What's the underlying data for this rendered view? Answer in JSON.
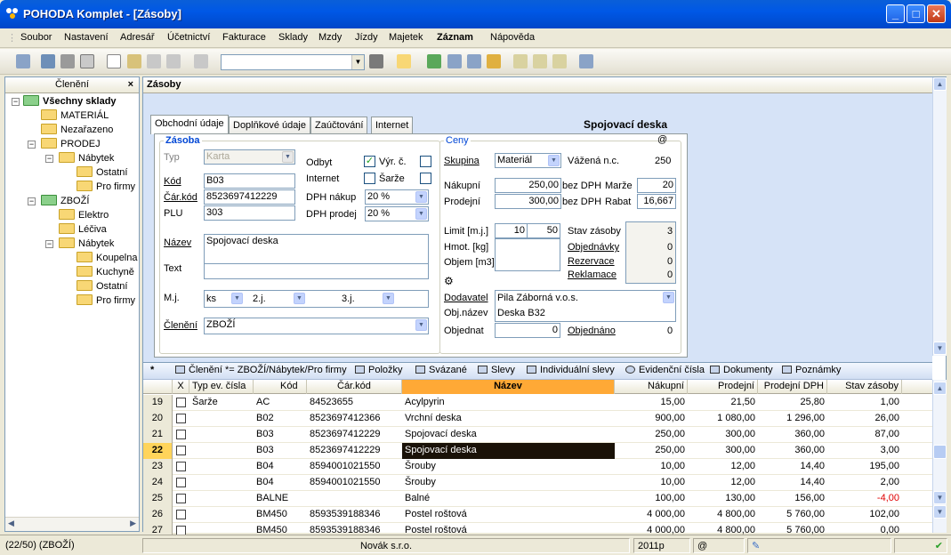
{
  "window": {
    "title": "POHODA Komplet - [Zásoby]"
  },
  "menu": [
    "Soubor",
    "Nastavení",
    "Adresář",
    "Účetnictví",
    "Fakturace",
    "Sklady",
    "Mzdy",
    "Jízdy",
    "Majetek",
    "Záznam",
    "Nápověda"
  ],
  "tree": {
    "header": "Členění",
    "close": "×",
    "nodes": [
      "Všechny sklady",
      "MATERIÁL",
      "Nezařazeno",
      "PRODEJ",
      "Nábytek",
      "Ostatní",
      "Pro firmy",
      "ZBOŽÍ",
      "Elektro",
      "Léčiva",
      "Nábytek",
      "Koupelna",
      "Kuchyně",
      "Ostatní",
      "Pro firmy"
    ]
  },
  "agenda": {
    "title": "Zásoby"
  },
  "tabs": [
    "Obchodní údaje",
    "Doplňkové údaje",
    "Zaúčtování",
    "Internet"
  ],
  "record_title": "Spojovací deska",
  "at_sign": "@",
  "zasoba": {
    "group": "Zásoba",
    "typ_label": "Typ",
    "typ_value": "Karta",
    "kod_label": "Kód",
    "kod_value": "B03",
    "ckod_label": "Čár.kód",
    "ckod_value": "8523697412229",
    "plu_label": "PLU",
    "plu_value": "303",
    "odbyt_label": "Odbyt",
    "vyr_label": "Výr. č.",
    "internet_label": "Internet",
    "sarze_label": "Šarže",
    "dph_nakup_label": "DPH nákup",
    "dph_nakup_value": "20 %",
    "dph_prodej_label": "DPH prodej",
    "dph_prodej_value": "20 %",
    "nazev_label": "Název",
    "nazev_value": "Spojovací deska",
    "text_label": "Text",
    "mj_label": "M.j.",
    "mj_value": "ks",
    "j2_label": "2.j.",
    "j3_label": "3.j.",
    "cleneni_label": "Členění",
    "cleneni_value": "ZBOŽÍ"
  },
  "ceny": {
    "group": "Ceny",
    "skupina_label": "Skupina",
    "skupina_value": "Materiál",
    "vazena_label": "Vážená n.c.",
    "vazena_value": "250",
    "nakupni_label": "Nákupní",
    "nakupni_value": "250,00",
    "bez_dph1": "bez DPH",
    "marze_label": "Marže",
    "marze_value": "20",
    "prodejni_label": "Prodejní",
    "prodejni_value": "300,00",
    "bez_dph2": "bez DPH",
    "rabat_label": "Rabat",
    "rabat_value": "16,667",
    "limit_label": "Limit [m.j.]",
    "limit_min": "10",
    "limit_max": "50",
    "hmot_label": "Hmot. [kg]",
    "objem_label": "Objem [m3]",
    "stav_label": "Stav zásoby",
    "stav_value": "3",
    "objednavky_label": "Objednávky",
    "objednavky_value": "0",
    "rezervace_label": "Rezervace",
    "rezervace_value": "0",
    "reklamace_label": "Reklamace",
    "reklamace_value": "0",
    "dodavatel_label": "Dodavatel",
    "dodavatel_value": "Pila Záborná v.o.s.",
    "objnazev_label": "Obj.název",
    "objnazev_value": "Deska B32",
    "objednat_label": "Objednat",
    "objednat_value": "0",
    "objednano_label": "Objednáno",
    "objednano_value": "0"
  },
  "strip": [
    "*",
    "Členění *= ZBOŽÍ/Nábytek/Pro firmy",
    "Položky",
    "Svázané",
    "Slevy",
    "Individuální slevy",
    "Evidenční čísla",
    "Dokumenty",
    "Poznámky"
  ],
  "grid": {
    "columns": [
      "X",
      "Typ ev. čísla",
      "Kód",
      "Čár.kód",
      "Název",
      "Nákupní",
      "Prodejní",
      "Prodejní DPH",
      "Stav zásoby"
    ],
    "rows": [
      {
        "n": "19",
        "typ": "Šarže",
        "kod": "AC",
        "ckod": "84523655",
        "nazev": "Acylpyrin",
        "nak": "15,00",
        "pro": "21,50",
        "dph": "25,80",
        "stav": "1,00"
      },
      {
        "n": "20",
        "typ": "",
        "kod": "B02",
        "ckod": "8523697412366",
        "nazev": "Vrchní deska",
        "nak": "900,00",
        "pro": "1 080,00",
        "dph": "1 296,00",
        "stav": "26,00"
      },
      {
        "n": "21",
        "typ": "",
        "kod": "B03",
        "ckod": "8523697412229",
        "nazev": "Spojovací deska",
        "nak": "250,00",
        "pro": "300,00",
        "dph": "360,00",
        "stav": "87,00"
      },
      {
        "n": "22",
        "typ": "",
        "kod": "B03",
        "ckod": "8523697412229",
        "nazev": "Spojovací deska",
        "nak": "250,00",
        "pro": "300,00",
        "dph": "360,00",
        "stav": "3,00"
      },
      {
        "n": "23",
        "typ": "",
        "kod": "B04",
        "ckod": "8594001021550",
        "nazev": "Šrouby",
        "nak": "10,00",
        "pro": "12,00",
        "dph": "14,40",
        "stav": "195,00"
      },
      {
        "n": "24",
        "typ": "",
        "kod": "B04",
        "ckod": "8594001021550",
        "nazev": "Šrouby",
        "nak": "10,00",
        "pro": "12,00",
        "dph": "14,40",
        "stav": "2,00"
      },
      {
        "n": "25",
        "typ": "",
        "kod": "BALNE",
        "ckod": "",
        "nazev": "Balné",
        "nak": "100,00",
        "pro": "130,00",
        "dph": "156,00",
        "stav": "-4,00"
      },
      {
        "n": "26",
        "typ": "",
        "kod": "BM450",
        "ckod": "8593539188346",
        "nazev": "Postel roštová",
        "nak": "4 000,00",
        "pro": "4 800,00",
        "dph": "5 760,00",
        "stav": "102,00"
      },
      {
        "n": "27",
        "typ": "",
        "kod": "BM450",
        "ckod": "8593539188346",
        "nazev": "Postel roštová",
        "nak": "4 000,00",
        "pro": "4 800,00",
        "dph": "5 760,00",
        "stav": "0,00"
      }
    ]
  },
  "status": {
    "records": "(22/50) (ZBOŽÍ)",
    "company": "Novák s.r.o.",
    "year": "2011p",
    "at": "@"
  },
  "colors": {
    "title_bar": "#0058E6",
    "form_bg": "#D6E3F7",
    "current_row": "#FFD45A",
    "negative": "#E00000"
  }
}
